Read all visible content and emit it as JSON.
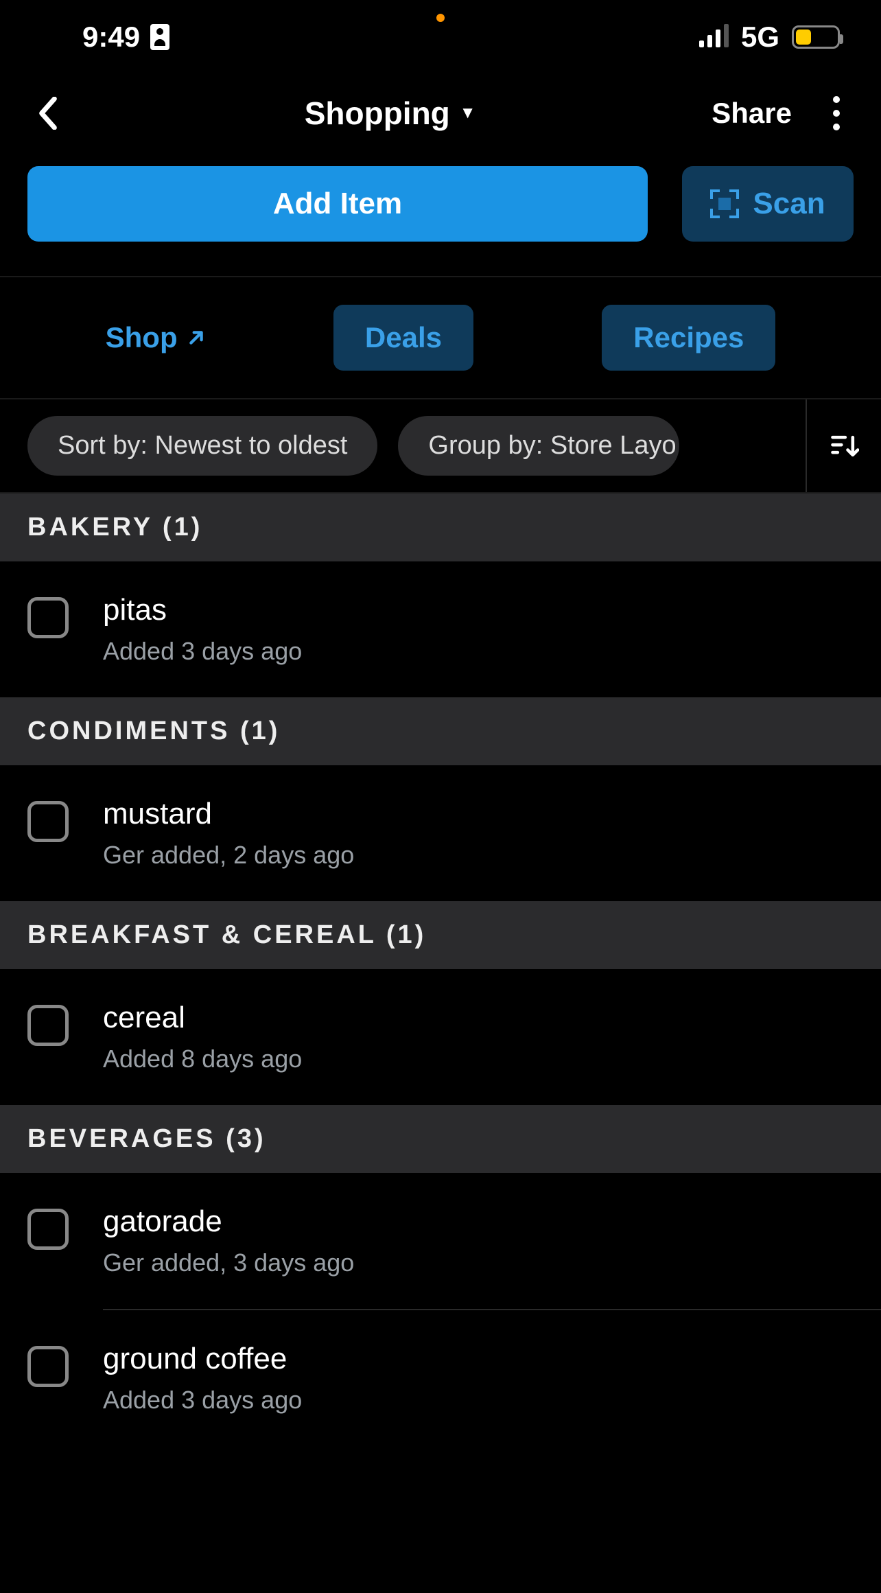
{
  "status": {
    "time": "9:49",
    "network": "5G"
  },
  "header": {
    "title": "Shopping",
    "share": "Share"
  },
  "actions": {
    "add": "Add Item",
    "scan": "Scan"
  },
  "nav": {
    "shop": "Shop",
    "deals": "Deals",
    "recipes": "Recipes"
  },
  "filters": {
    "sort": "Sort by: Newest to oldest",
    "group": "Group by: Store Layo"
  },
  "sections": [
    {
      "title": "BAKERY (1)",
      "items": [
        {
          "name": "pitas",
          "meta": "Added 3 days ago"
        }
      ]
    },
    {
      "title": "CONDIMENTS (1)",
      "items": [
        {
          "name": "mustard",
          "meta": "Ger added, 2 days ago"
        }
      ]
    },
    {
      "title": "BREAKFAST & CEREAL (1)",
      "items": [
        {
          "name": "cereal",
          "meta": "Added 8 days ago"
        }
      ]
    },
    {
      "title": "BEVERAGES (3)",
      "items": [
        {
          "name": "gatorade",
          "meta": "Ger added, 3 days ago"
        },
        {
          "name": "ground coffee",
          "meta": "Added 3 days ago"
        }
      ]
    }
  ]
}
